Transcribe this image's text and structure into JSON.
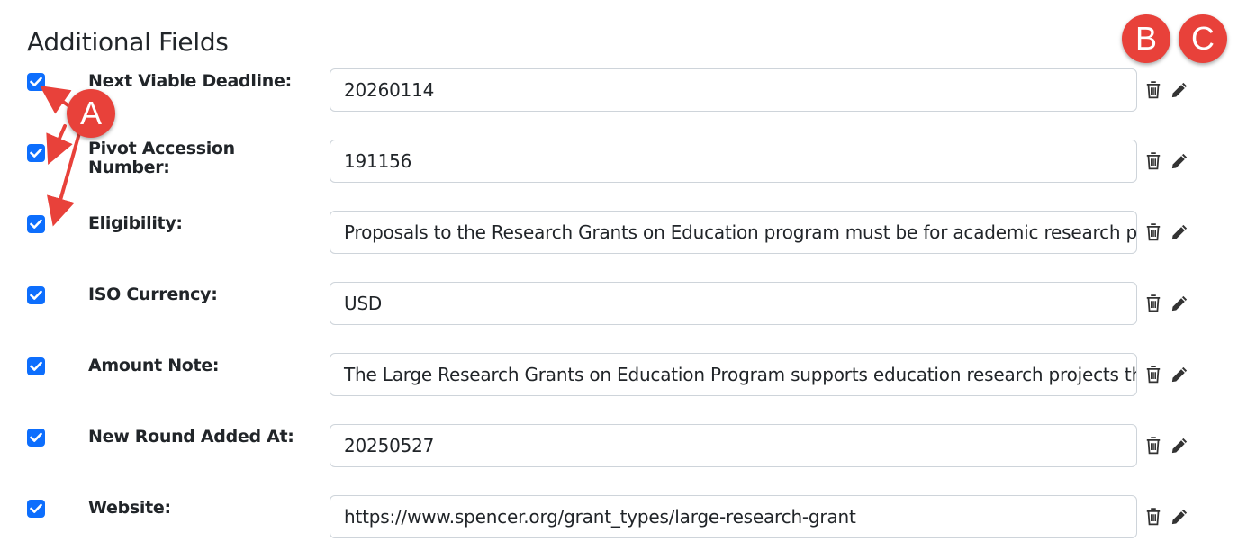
{
  "section": {
    "title": "Additional Fields"
  },
  "fields": [
    {
      "label": "Next Viable Deadline:",
      "value": "20260114",
      "checked": true
    },
    {
      "label": "Pivot Accession Number:",
      "value": "191156",
      "checked": true
    },
    {
      "label": "Eligibility:",
      "value": "Proposals to the Research Grants on Education program must be for academic research projects",
      "checked": true
    },
    {
      "label": "ISO Currency:",
      "value": "USD",
      "checked": true
    },
    {
      "label": "Amount Note:",
      "value": "The Large Research Grants on Education Program supports education research projects that will",
      "checked": true
    },
    {
      "label": "New Round Added At:",
      "value": "20250527",
      "checked": true
    },
    {
      "label": "Website:",
      "value": "https://www.spencer.org/grant_types/large-research-grant",
      "checked": true
    }
  ],
  "actions": {
    "delete_icon": "trash-icon",
    "edit_icon": "pencil-icon"
  },
  "callouts": {
    "a": "A",
    "b": "B",
    "c": "C"
  },
  "colors": {
    "checkbox": "#0d6efd",
    "callout": "#e8413a",
    "border": "#ced4da"
  }
}
